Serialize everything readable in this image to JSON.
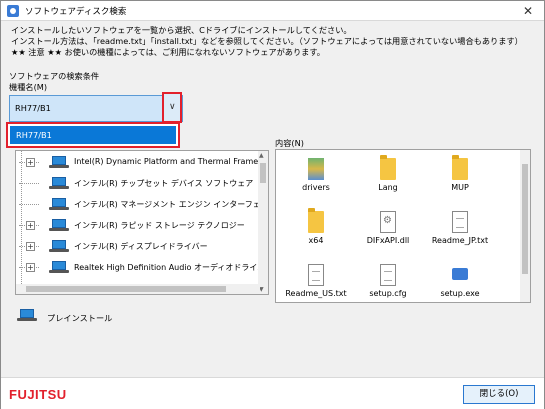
{
  "window": {
    "title": "ソフトウェアディスク検索",
    "close_glyph": "✕"
  },
  "info": {
    "line1": "インストールしたいソフトウェアを一覧から選択、Cドライブにインストールしてください。",
    "line2": "インストール方法は、「readme.txt」「install.txt」などを参照してください。（ソフトウェアによっては用意されていない場合もあります）",
    "line3": "★★ 注意 ★★ お使いの機種によっては、ご利用になれないソフトウェアがあります。"
  },
  "search": {
    "section_label": "ソフトウェアの検索条件",
    "model_label": "機種名(M)",
    "model_value": "RH77/B1",
    "dropdown_options": [
      "RH77/B1"
    ]
  },
  "tree": {
    "items": [
      {
        "label": "Intel(R) Dynamic Platform and Thermal Framewo",
        "expander": "+"
      },
      {
        "label": "インテル(R) チップセット デバイス ソフトウェア",
        "expander": ""
      },
      {
        "label": "インテル(R) マネージメント エンジン インターフェイ",
        "expander": ""
      },
      {
        "label": "インテル(R) ラピッド ストレージ テクノロジー",
        "expander": "+"
      },
      {
        "label": "インテル(R) ディスプレイドライバー",
        "expander": "+"
      },
      {
        "label": "Realtek High Definition Audio オーディオドライバ",
        "expander": "+"
      }
    ]
  },
  "content": {
    "label": "内容(N)",
    "files": [
      {
        "name": "drivers",
        "type": "bars"
      },
      {
        "name": "Lang",
        "type": "folder"
      },
      {
        "name": "MUP",
        "type": "folder"
      },
      {
        "name": "x64",
        "type": "folder"
      },
      {
        "name": "DIFxAPI.dll",
        "type": "dll"
      },
      {
        "name": "Readme_JP.txt",
        "type": "doc"
      },
      {
        "name": "Readme_US.txt",
        "type": "doc"
      },
      {
        "name": "setup.cfg",
        "type": "doc"
      },
      {
        "name": "setup.exe",
        "type": "exe"
      }
    ]
  },
  "preinstall": {
    "label": "プレインストール"
  },
  "footer": {
    "logo": "FUJITSU",
    "close_label": "閉じる(O)"
  },
  "colors": {
    "accent": "#0a78d7",
    "highlight_border": "#e2202c",
    "logo": "#e2202c"
  }
}
